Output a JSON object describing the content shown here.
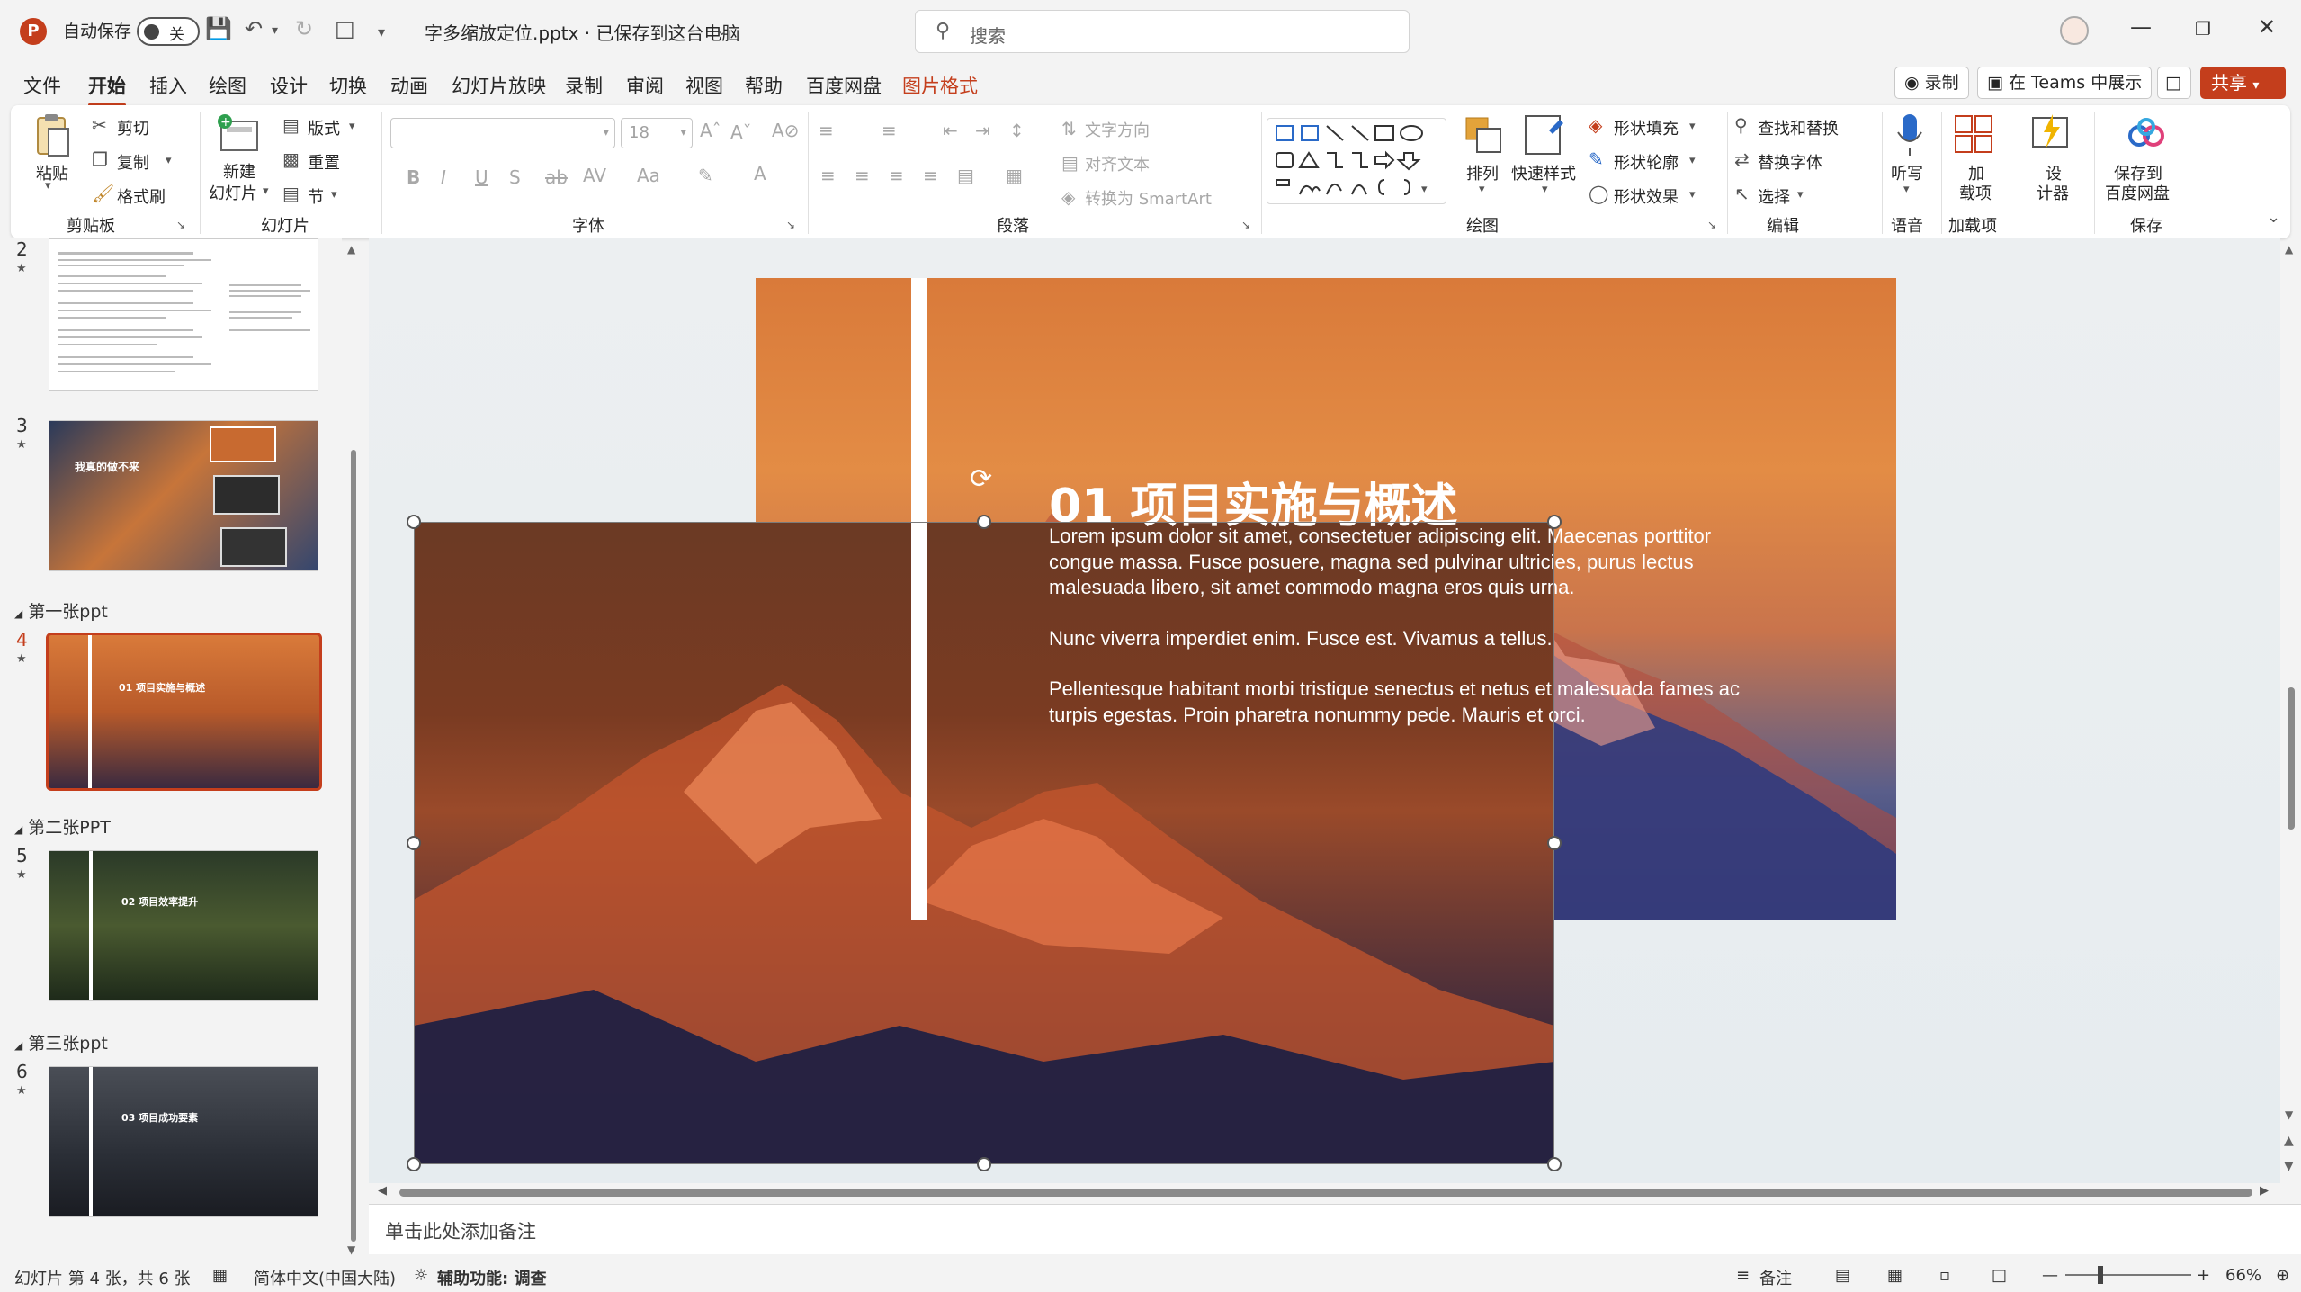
{
  "titlebar": {
    "app_icon": "P",
    "autosave_label": "自动保存",
    "autosave_state": "关",
    "filename": "字多缩放定位.pptx · 已保存到这台电脑",
    "search_placeholder": "搜索"
  },
  "menu": {
    "tabs": [
      "文件",
      "开始",
      "插入",
      "绘图",
      "设计",
      "切换",
      "动画",
      "幻灯片放映",
      "录制",
      "审阅",
      "视图",
      "帮助",
      "百度网盘",
      "图片格式"
    ],
    "record_label": "录制",
    "teams_label": "在 Teams 中展示",
    "share_label": "共享"
  },
  "ribbon": {
    "clipboard": {
      "paste": "粘贴",
      "cut": "剪切",
      "copy": "复制",
      "format_painter": "格式刷",
      "label": "剪贴板"
    },
    "slides": {
      "new_slide_1": "新建",
      "new_slide_2": "幻灯片",
      "layout": "版式",
      "reset": "重置",
      "section": "节",
      "label": "幻灯片"
    },
    "font": {
      "size": "18",
      "label": "字体"
    },
    "paragraph": {
      "text_direction": "文字方向",
      "align_text": "对齐文本",
      "convert_smartart": "转换为 SmartArt",
      "label": "段落"
    },
    "drawing": {
      "arrange": "排列",
      "quick_styles": "快速样式",
      "shape_fill": "形状填充",
      "shape_outline": "形状轮廓",
      "shape_effects": "形状效果",
      "label": "绘图"
    },
    "editing": {
      "find_replace": "查找和替换",
      "replace_font": "替换字体",
      "select": "选择",
      "label": "编辑"
    },
    "voice": {
      "dictate": "听写",
      "label": "语音"
    },
    "addins": {
      "addins_1": "加",
      "addins_2": "载项",
      "label": "加载项"
    },
    "designer": {
      "line1": "设",
      "line2": "计器"
    },
    "save": {
      "line1": "保存到",
      "line2": "百度网盘",
      "label": "保存"
    }
  },
  "thumbnails": {
    "slides": [
      {
        "num": "2"
      },
      {
        "num": "3",
        "title": "我真的做不来"
      },
      {
        "num": "4",
        "title": "01 项目实施与概述"
      },
      {
        "num": "5",
        "title": "02 项目效率提升"
      },
      {
        "num": "6",
        "title": "03 项目成功要素"
      }
    ],
    "sections": [
      "第一张ppt",
      "第二张PPT",
      "第三张ppt"
    ]
  },
  "slide": {
    "title": "01 项目实施与概述",
    "para1": "Lorem ipsum dolor sit amet, consectetuer adipiscing elit. Maecenas porttitor congue massa. Fusce posuere, magna sed pulvinar ultricies, purus lectus malesuada libero, sit amet commodo magna eros quis urna.",
    "para2": "Nunc viverra imperdiet enim. Fusce est. Vivamus a tellus.",
    "para3": "Pellentesque habitant morbi tristique senectus et netus et malesuada fames ac turpis egestas. Proin pharetra nonummy pede. Mauris et orci."
  },
  "notes": {
    "placeholder": "单击此处添加备注"
  },
  "status": {
    "slide_info": "幻灯片 第 4 张，共 6 张",
    "language": "简体中文(中国大陆)",
    "accessibility": "辅助功能: 调查",
    "notes": "备注",
    "zoom": "66%"
  },
  "colors": {
    "accent": "#c43e1c",
    "ribbon_bg": "#ffffff",
    "chrome_bg": "#f3f3f3"
  }
}
